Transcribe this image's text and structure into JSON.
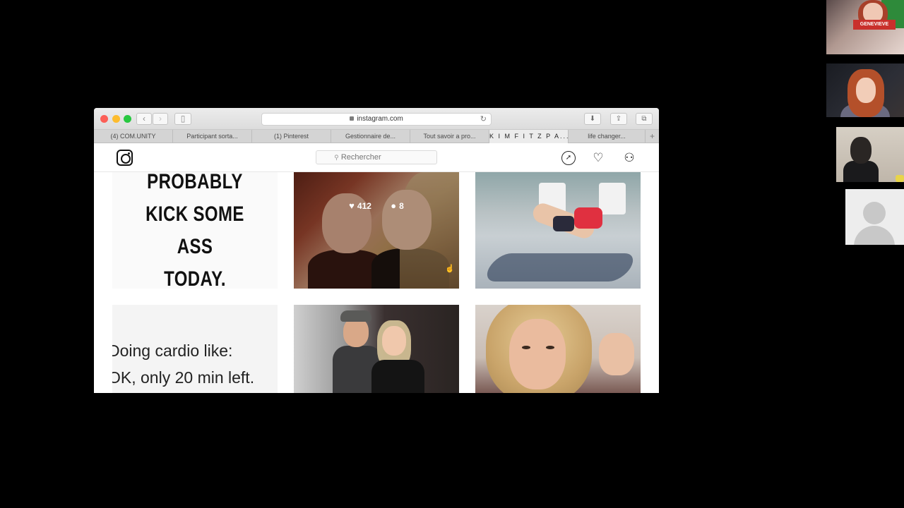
{
  "browser": {
    "url": "instagram.com",
    "tabs": [
      {
        "label": "(4) COM.UNITY",
        "active": false
      },
      {
        "label": "Participant sorta...",
        "active": false
      },
      {
        "label": "(1) Pinterest",
        "active": false
      },
      {
        "label": "Gestionnaire de...",
        "active": false
      },
      {
        "label": "Tout savoir a pro...",
        "active": false
      },
      {
        "label": "K I M F I T Z P A...",
        "active": true
      },
      {
        "label": "life changer...",
        "active": false
      }
    ],
    "new_tab_label": "+"
  },
  "instagram": {
    "search_placeholder": "Rechercher"
  },
  "posts": {
    "quote_text": "PROBABLY\nKICK SOME ASS\nTODAY.",
    "friends_likes": "412",
    "friends_comments": "8",
    "cardio_text": "Doing cardio like:\nOK, only 20 min left."
  },
  "participants": {
    "p1_banner": "GENEVIEVE"
  },
  "colors": {
    "accent_red": "#fc5f57",
    "accent_yellow": "#fdbc2e",
    "accent_green": "#27c840"
  }
}
